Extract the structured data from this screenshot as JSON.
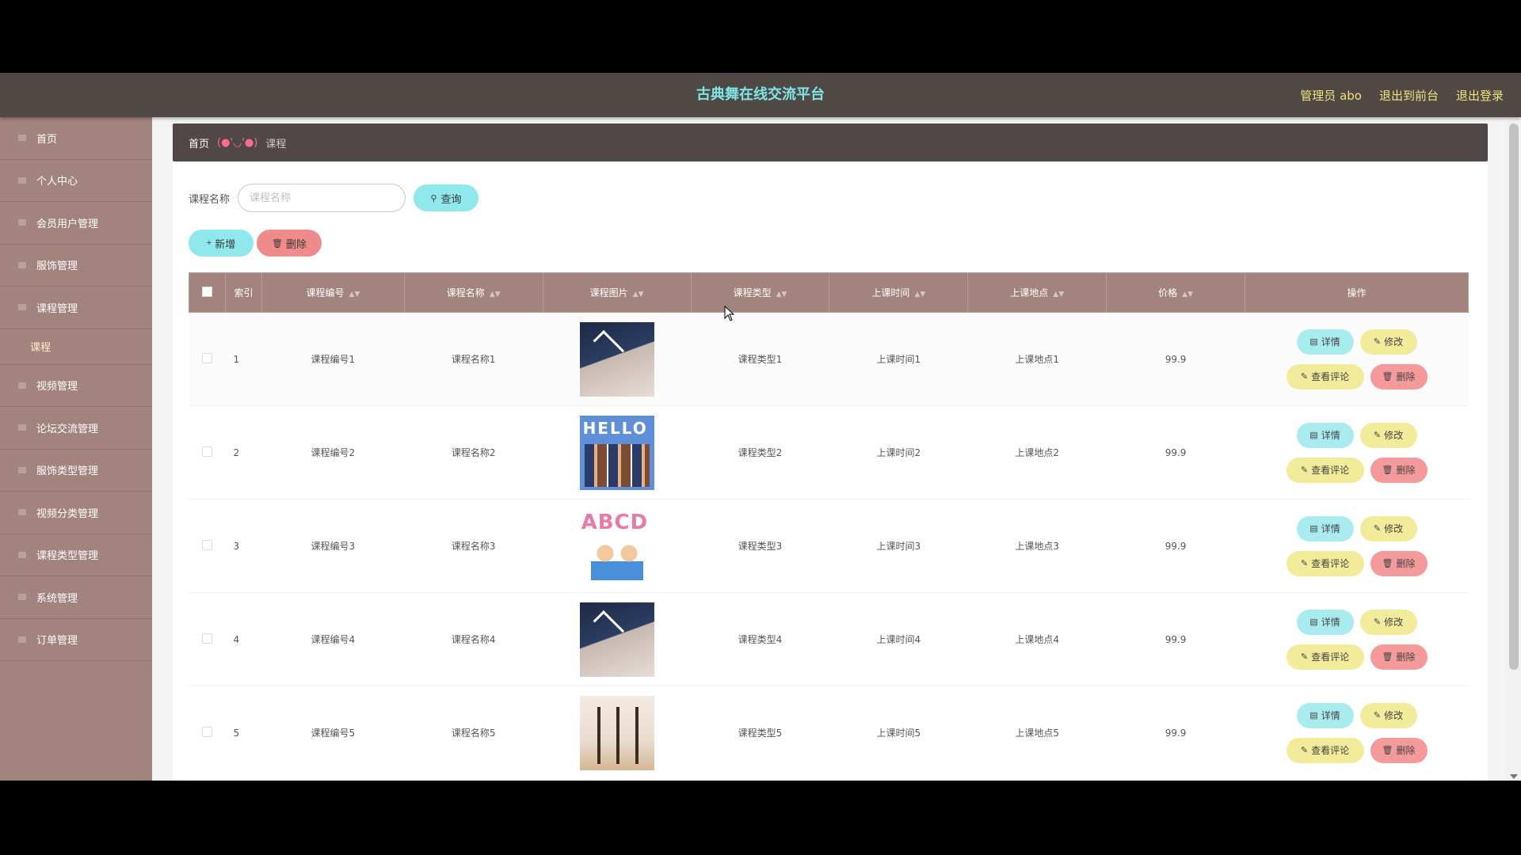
{
  "header": {
    "title": "古典舞在线交流平台",
    "admin_label": "管理员 abo",
    "front_link": "退出到前台",
    "logout_link": "退出登录"
  },
  "sidebar": {
    "items": [
      {
        "label": "首页",
        "icon": "home-icon"
      },
      {
        "label": "个人中心",
        "icon": "user-icon"
      },
      {
        "label": "会员用户管理",
        "icon": "users-icon"
      },
      {
        "label": "服饰管理",
        "icon": "menu-icon"
      },
      {
        "label": "课程管理",
        "icon": "menu-icon"
      },
      {
        "label": "视频管理",
        "icon": "menu-icon"
      },
      {
        "label": "论坛交流管理",
        "icon": "menu-icon"
      },
      {
        "label": "服饰类型管理",
        "icon": "menu-icon"
      },
      {
        "label": "视频分类管理",
        "icon": "menu-icon"
      },
      {
        "label": "课程类型管理",
        "icon": "menu-icon"
      },
      {
        "label": "系统管理",
        "icon": "menu-icon"
      },
      {
        "label": "订单管理",
        "icon": "menu-icon"
      }
    ],
    "submenu": {
      "label": "课程"
    }
  },
  "breadcrumb": {
    "home": "首页",
    "separator": "(●'◡'●)",
    "current": "课程"
  },
  "search": {
    "label": "课程名称",
    "placeholder": "课程名称",
    "value": "",
    "button": "查询"
  },
  "actions": {
    "add": "新增",
    "delete": "删除"
  },
  "table": {
    "columns": [
      "索引",
      "课程编号",
      "课程名称",
      "课程图片",
      "课程类型",
      "上课时间",
      "上课地点",
      "价格",
      "操作"
    ],
    "rows": [
      {
        "index": "1",
        "code": "课程编号1",
        "name": "课程名称1",
        "image": "t-dark",
        "type": "课程类型1",
        "time": "上课时间1",
        "place": "上课地点1",
        "price": "99.9"
      },
      {
        "index": "2",
        "code": "课程编号2",
        "name": "课程名称2",
        "image": "t-hello",
        "type": "课程类型2",
        "time": "上课时间2",
        "place": "上课地点2",
        "price": "99.9"
      },
      {
        "index": "3",
        "code": "课程编号3",
        "name": "课程名称3",
        "image": "t-abcd",
        "type": "课程类型3",
        "time": "上课时间3",
        "place": "上课地点3",
        "price": "99.9"
      },
      {
        "index": "4",
        "code": "课程编号4",
        "name": "课程名称4",
        "image": "t-dark",
        "type": "课程类型4",
        "time": "上课时间4",
        "place": "上课地点4",
        "price": "99.9"
      },
      {
        "index": "5",
        "code": "课程编号5",
        "name": "课程名称5",
        "image": "t-dance",
        "type": "课程类型5",
        "time": "上课时间5",
        "place": "上课地点5",
        "price": "99.9"
      }
    ],
    "row_actions": {
      "detail": "详情",
      "edit": "修改",
      "review": "查看评论",
      "delete": "删除"
    }
  },
  "colors": {
    "topbar": "#504845",
    "sidebar": "#a2837e",
    "title": "#7ee6e6",
    "header_links": "#f0e27e"
  }
}
